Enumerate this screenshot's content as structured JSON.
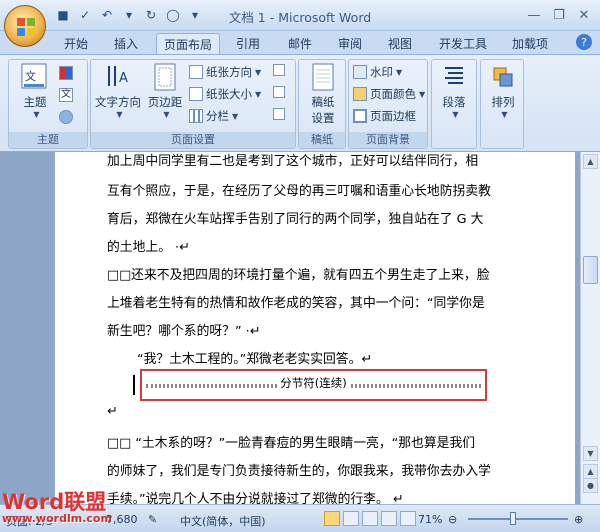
{
  "window": {
    "title": "文档 1 - Microsoft Word"
  },
  "tabs": [
    "开始",
    "插入",
    "页面布局",
    "引用",
    "邮件",
    "审阅",
    "视图",
    "开发工具",
    "加载项"
  ],
  "active_tab": "页面布局",
  "ribbon": {
    "theme": {
      "label": "主题",
      "group": "主题"
    },
    "page_setup": {
      "group": "页面设置",
      "text_direction": "文字方向",
      "margins": "页边距",
      "orientation": "纸张方向",
      "size": "纸张大小",
      "columns": "分栏"
    },
    "draft": {
      "group": "稿纸",
      "label_line1": "稿纸",
      "label_line2": "设置"
    },
    "page_bg": {
      "group": "页面背景",
      "watermark": "水印",
      "page_color": "页面颜色",
      "page_border": "页面边框"
    },
    "paragraph": "段落",
    "arrange": "排列"
  },
  "document": {
    "lines": [
      "加上周中同学里有二也是考到了这个城市，正好可以结伴同行，相",
      "互有个照应，于是，在经历了父母的再三叮嘱和语重心长地防拐卖教",
      "育后，郑微在火车站挥手告别了同行的两个同学，独自站在了 G 大",
      "的土地上。 ·↵",
      "□□还来不及把四周的环境打量个遍，就有四五个男生走了上来，脸",
      "上堆着老生特有的热情和故作老成的笑容，其中一个问：“同学你是",
      "新生吧？哪个系的呀？” ·↵",
      "“我？土木工程的。”郑微老老实实回答。↵",
      "↵",
      "□□ “土木系的呀？”一脸青春痘的男生眼睛一亮，“那也算是我们",
      "的师妹了，我们是专门负责接待新生的，你跟我来，我带你去办入学",
      "手续。”说完几个人不由分说就接过了郑微的行李。 ↵"
    ],
    "section_break_label": "分节符(连续)"
  },
  "statusbar": {
    "page": "页面: 2/5",
    "words": "2,680",
    "language": "中文(简体，中国)",
    "zoom": "71%"
  },
  "watermark_logo": {
    "brand": "Word联盟",
    "url": "www.wordlm.com"
  }
}
